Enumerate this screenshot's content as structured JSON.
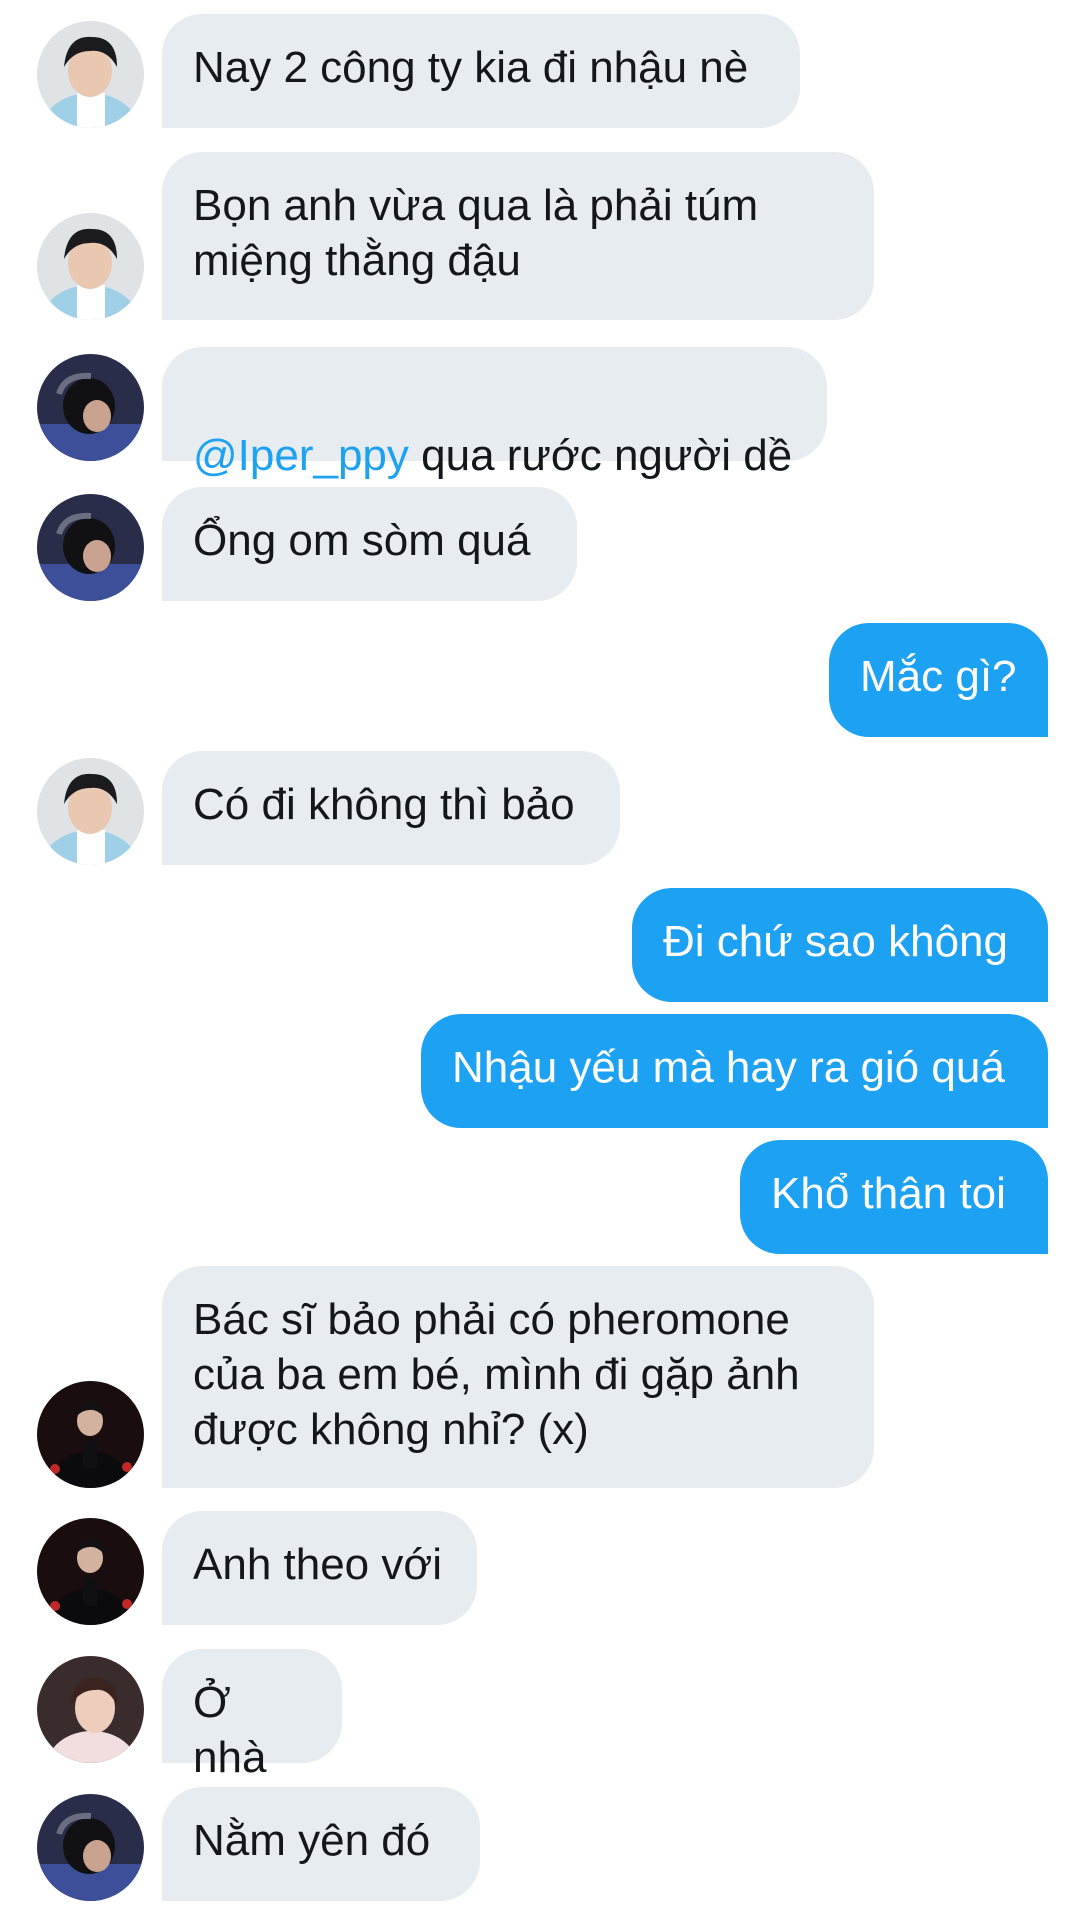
{
  "messages": [
    {
      "side": "in",
      "avatar": "avatar-a",
      "text": "Nay 2 công ty kia đi nhậu nè"
    },
    {
      "side": "in",
      "avatar": "avatar-a",
      "text": "Bọn anh vừa qua là phải túm\nmiệng thằng đậu"
    },
    {
      "side": "in",
      "avatar": "avatar-b",
      "mention": "@Iper_ppy",
      "text": " qua rước người dề"
    },
    {
      "side": "in",
      "avatar": "avatar-b",
      "text": "Ổng om sòm quá"
    },
    {
      "side": "out",
      "text": "Mắc gì?"
    },
    {
      "side": "in",
      "avatar": "avatar-a",
      "text": "Có đi không thì bảo"
    },
    {
      "side": "out",
      "text": "Đi chứ sao không"
    },
    {
      "side": "out",
      "text": "Nhậu yếu mà hay ra gió quá"
    },
    {
      "side": "out",
      "text": "Khổ thân toi"
    },
    {
      "side": "in",
      "avatar": "avatar-c",
      "text": "Bác sĩ bảo phải có pheromone\ncủa ba em bé, mình đi gặp ảnh\nđược không nhỉ? (x)"
    },
    {
      "side": "in",
      "avatar": "avatar-c",
      "text": "Anh theo với"
    },
    {
      "side": "in",
      "avatar": "avatar-d",
      "text": "Ở nhà"
    },
    {
      "side": "in",
      "avatar": "avatar-b",
      "text": "Nằm yên đó"
    }
  ],
  "colors": {
    "incoming_bubble": "#e6ecf0",
    "outgoing_bubble": "#1da1f2",
    "mention": "#1da1f2",
    "text": "#14171a"
  }
}
